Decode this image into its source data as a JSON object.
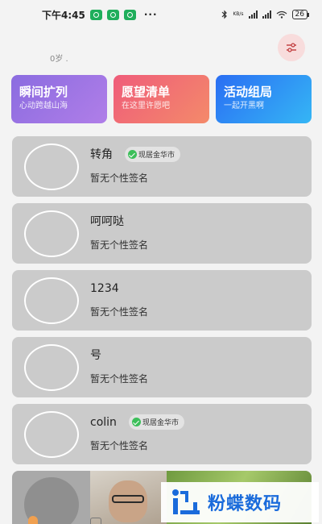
{
  "status_bar": {
    "time": "下午4:45",
    "more": "···",
    "network_speed": "KB/s",
    "battery": "26"
  },
  "profile": {
    "age": "0岁 ."
  },
  "features": [
    {
      "title": "瞬间扩列",
      "subtitle": "心动跨越山海"
    },
    {
      "title": "愿望清单",
      "subtitle": "在这里许愿吧"
    },
    {
      "title": "活动组局",
      "subtitle": "一起开黑啊"
    }
  ],
  "users": [
    {
      "name": "转角",
      "location": "现居金华市",
      "signature": "暂无个性签名"
    },
    {
      "name": "呵呵哒",
      "location": "",
      "signature": "暂无个性签名"
    },
    {
      "name": "1234",
      "location": "",
      "signature": "暂无个性签名"
    },
    {
      "name": "号",
      "location": "",
      "signature": "暂无个性签名"
    },
    {
      "name": "colin",
      "location": "现居金华市",
      "signature": "暂无个性签名"
    }
  ],
  "watermark": {
    "text": "粉蝶数码"
  },
  "colors": {
    "accent_green": "#3cbf5a",
    "brand_blue": "#1a6bdb"
  }
}
